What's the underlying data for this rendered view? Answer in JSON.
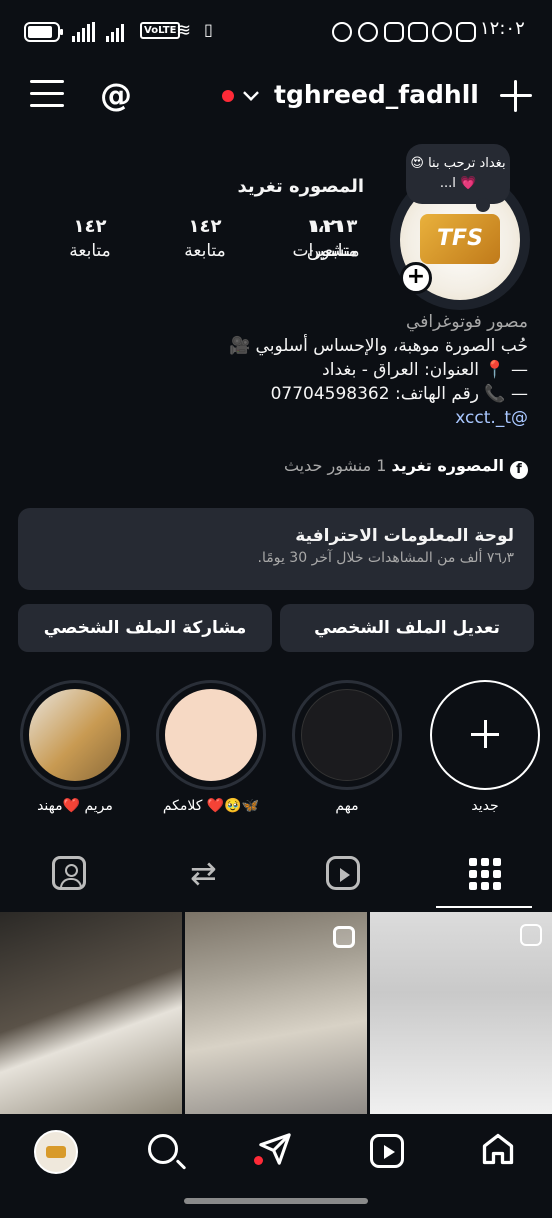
{
  "status_bar": {
    "time": "١٢:٠٢",
    "volte_label": "VoLTE"
  },
  "header": {
    "username": "tghreed_fadhll"
  },
  "profile": {
    "note": "بغداد ترحب بنا 😍💗 ا...",
    "display_name": "المصوره تغريد",
    "stats": [
      {
        "value": "١١٦",
        "label": "منشورات"
      },
      {
        "value": "١،٢١٣",
        "label": "متابعين"
      },
      {
        "value": "١٤٢",
        "label": "متابعة"
      }
    ],
    "bio": {
      "category": "مصور فوتوغرافي",
      "line1": "حُب الصورة موهبة، والإحساس أسلوبي 🎥",
      "line2": "— 📍 العنوان: العراق - بغداد",
      "line3": "— 📞 رقم الهاتف: 07704598362",
      "link": "xcct._t"
    },
    "facebook": {
      "name": "المصوره تغريد",
      "sub": "1 منشور حديث"
    }
  },
  "dashboard": {
    "title": "لوحة المعلومات الاحترافية",
    "subtitle": "٧٦٫٣ ألف من المشاهدات خلال آخر 30 يومًا."
  },
  "buttons": {
    "edit": "تعديل الملف الشخصي",
    "share": "مشاركة الملف الشخصي"
  },
  "highlights": [
    {
      "label": "جديد"
    },
    {
      "label": "مهم"
    },
    {
      "label": "كلامكم ❤️🥹🦋"
    },
    {
      "label": "مريم ❤️مهند"
    }
  ],
  "tabs": [
    "grid",
    "reels",
    "reposts",
    "tagged"
  ],
  "colors": {
    "background": "#0c0f14",
    "surface": "#262a33",
    "accent_red": "#ff2a37",
    "link": "#a9c7ff"
  }
}
